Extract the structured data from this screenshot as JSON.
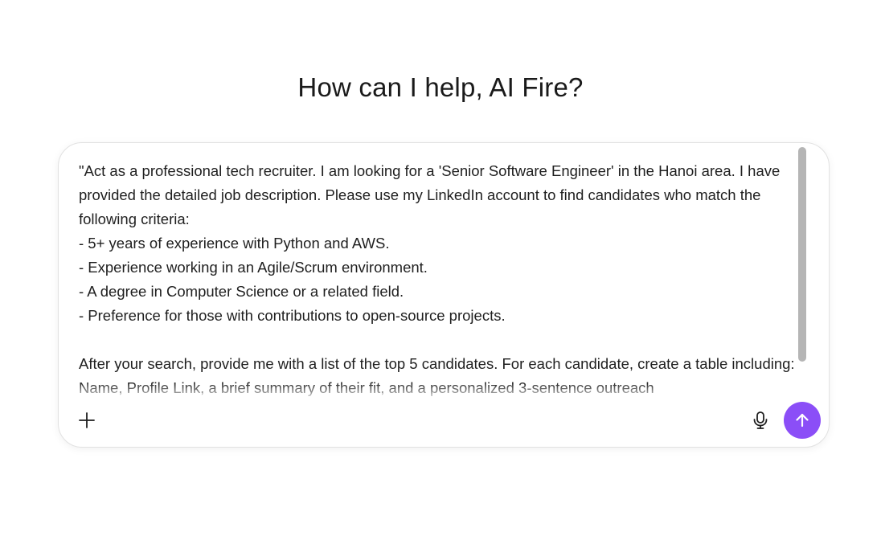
{
  "greeting": "How can I help, AI Fire?",
  "prompt": {
    "value": "\"Act as a professional tech recruiter. I am looking for a 'Senior Software Engineer' in the Hanoi area. I have provided the detailed job description. Please use my LinkedIn account to find candidates who match the following criteria:\n- 5+ years of experience with Python and AWS.\n- Experience working in an Agile/Scrum environment.\n- A degree in Computer Science or a related field.\n- Preference for those with contributions to open-source projects.\n\nAfter your search, provide me with a list of the top 5 candidates. For each candidate, create a table including: Name, Profile Link, a brief summary of their fit, and a personalized 3-sentence outreach"
  },
  "toolbar": {
    "add_icon": "plus-icon",
    "mic_icon": "microphone-icon",
    "send_icon": "arrow-up-icon"
  },
  "colors": {
    "accent": "#8b4ef7",
    "scrollbar": "#b5b5b5",
    "border": "#e2e2e2"
  }
}
